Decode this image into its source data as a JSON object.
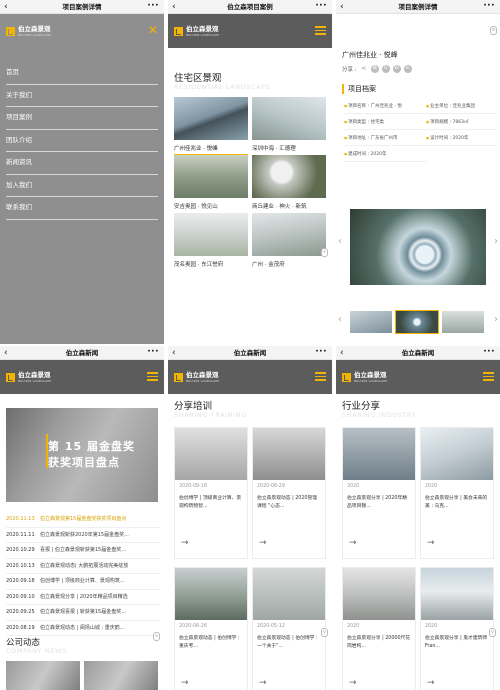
{
  "colors": {
    "accent": "#f2b400",
    "header_bg": "#5c5c5c",
    "menu_bg": "#8f8f8f"
  },
  "common": {
    "more": "···",
    "back": "‹",
    "logo_cn": "伯立森景观",
    "logo_en": "BOLISEN LANDSCAPE",
    "menu_icon": "hamburger-icon",
    "close": "✕",
    "arrow": "→",
    "scroll_hint": "∨"
  },
  "panel1": {
    "wx_title": "项目案例详情",
    "nav": [
      "首页",
      "关于我们",
      "项目案例",
      "团队介绍",
      "新闻资讯",
      "加入我们",
      "联系我们"
    ]
  },
  "panel2": {
    "wx_title": "伯立森项目案例",
    "section_title": "住宅区景观",
    "section_ghost": "RESIDENTIAL LANDSCAPE",
    "projects": [
      {
        "name": "广州佳兆业 · 悦峰"
      },
      {
        "name": "深圳中海 · 汇德理"
      },
      {
        "name": "安吉奥园 · 悦见山"
      },
      {
        "name": "商丘建业 · 神火 · 新筑"
      },
      {
        "name": "茂名奥园 · 东江誉府"
      },
      {
        "name": "广州 · 金茂府"
      }
    ]
  },
  "panel3": {
    "wx_title": "项目案例详情",
    "project_title": "广州佳兆业 · 悦峰",
    "share_label": "分享 :",
    "archive_title": "项目档案",
    "archive": [
      "项目名称 : 广州佳兆业 · 悦",
      "业主单位 : 佳兆业集团",
      "项目类型 : 住宅类",
      "项目规模 : 7863㎡",
      "项目地址 : 广东省广州市",
      "设计时间 : 2020年",
      "建成时间 : 2020年"
    ],
    "prev": "‹",
    "next": "›"
  },
  "panel4": {
    "wx_title": "伯立森新闻",
    "banner_line1": "第 15 届金盘奖",
    "banner_line2": "获奖项目盘点",
    "news": [
      {
        "date": "2020.11.13",
        "title": "伯立森景观第15届金盘奖获奖项目盘点"
      },
      {
        "date": "2020.11.11",
        "title": "伯立森景观斩获2020年第15届金盘奖..."
      },
      {
        "date": "2020.10.29",
        "title": "喜报 | 伯立森景观斩获第15届金盘奖..."
      },
      {
        "date": "2020.10.13",
        "title": "伯立森景观动态| 大鹏拓展活动完美绽放"
      },
      {
        "date": "2020.09.18",
        "title": "伯创博学 | 顶级商业计算、景观构筑..."
      },
      {
        "date": "2020.09.10",
        "title": "伯立森景观分享 | 2020年精品项目精选"
      },
      {
        "date": "2020.09.25",
        "title": "伯立森景观喜报 | 斩获第15届金盘奖..."
      },
      {
        "date": "2020.08.19",
        "title": "伯立森景观动态 | 阖扬山城 : 重庆鹤..."
      }
    ],
    "company_title": "公司动态",
    "company_ghost": "COMPANY NEWS"
  },
  "panel5": {
    "wx_title": "伯立森新闻",
    "section_title": "分享培训",
    "section_ghost": "SHARING TRAINING",
    "cards": [
      {
        "date": "2020-09-18",
        "text": "伯创博学 | 顶级商业计算、景观构筑物智..."
      },
      {
        "date": "2020-08-29",
        "text": "伯立森景观动态 | 2020管理课程 \"心态..."
      },
      {
        "date": "2020-06-26",
        "text": "伯立森景观动态 | 伯创博学 : 重庆考..."
      },
      {
        "date": "2020-05-12",
        "text": "伯立森景观动态 | 伯创博学 : 一个关于\"..."
      }
    ]
  },
  "panel6": {
    "wx_title": "伯立森新闻",
    "section_title": "行业分享",
    "section_ghost": "SHARING INDUSTRY",
    "cards": [
      {
        "date": "2020",
        "text": "伯立森景观分享 | 2020年精品项目锦..."
      },
      {
        "date": "2020",
        "text": "伯立森景观分享 | 美会未来的美 : 乌克..."
      },
      {
        "date": "2020",
        "text": "伯立森景观分享 | 20000尺花岗岩构..."
      },
      {
        "date": "2020",
        "text": "伯立森景观分享 | 鬼才建筑师Fran..."
      }
    ]
  }
}
